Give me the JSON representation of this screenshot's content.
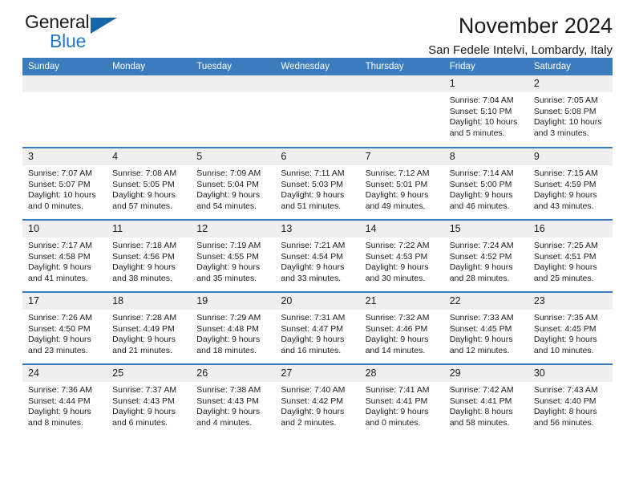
{
  "logo": {
    "primary_text": "General",
    "secondary_text": "Blue",
    "triangle_icon": "triangle-icon",
    "primary_color": "#1c1c1c",
    "secondary_color": "#2379c6",
    "triangle_color": "#1565a8"
  },
  "header": {
    "month_title": "November 2024",
    "location": "San Fedele Intelvi, Lombardy, Italy"
  },
  "colors": {
    "header_row_background": "#3a7cbe",
    "header_row_text": "#ffffff",
    "date_band_background": "#efefef",
    "cell_background": "#ffffff",
    "grid_line": "#3a7cbe",
    "body_text": "#1c1c1c"
  },
  "calendar": {
    "weekday_headers": [
      "Sunday",
      "Monday",
      "Tuesday",
      "Wednesday",
      "Thursday",
      "Friday",
      "Saturday"
    ],
    "weeks": [
      [
        {
          "day": "",
          "empty": true,
          "sunrise": "",
          "sunset": "",
          "daylight": ""
        },
        {
          "day": "",
          "empty": true,
          "sunrise": "",
          "sunset": "",
          "daylight": ""
        },
        {
          "day": "",
          "empty": true,
          "sunrise": "",
          "sunset": "",
          "daylight": ""
        },
        {
          "day": "",
          "empty": true,
          "sunrise": "",
          "sunset": "",
          "daylight": ""
        },
        {
          "day": "",
          "empty": true,
          "sunrise": "",
          "sunset": "",
          "daylight": ""
        },
        {
          "day": "1",
          "empty": false,
          "sunrise": "Sunrise: 7:04 AM",
          "sunset": "Sunset: 5:10 PM",
          "daylight": "Daylight: 10 hours and 5 minutes."
        },
        {
          "day": "2",
          "empty": false,
          "sunrise": "Sunrise: 7:05 AM",
          "sunset": "Sunset: 5:08 PM",
          "daylight": "Daylight: 10 hours and 3 minutes."
        }
      ],
      [
        {
          "day": "3",
          "empty": false,
          "sunrise": "Sunrise: 7:07 AM",
          "sunset": "Sunset: 5:07 PM",
          "daylight": "Daylight: 10 hours and 0 minutes."
        },
        {
          "day": "4",
          "empty": false,
          "sunrise": "Sunrise: 7:08 AM",
          "sunset": "Sunset: 5:05 PM",
          "daylight": "Daylight: 9 hours and 57 minutes."
        },
        {
          "day": "5",
          "empty": false,
          "sunrise": "Sunrise: 7:09 AM",
          "sunset": "Sunset: 5:04 PM",
          "daylight": "Daylight: 9 hours and 54 minutes."
        },
        {
          "day": "6",
          "empty": false,
          "sunrise": "Sunrise: 7:11 AM",
          "sunset": "Sunset: 5:03 PM",
          "daylight": "Daylight: 9 hours and 51 minutes."
        },
        {
          "day": "7",
          "empty": false,
          "sunrise": "Sunrise: 7:12 AM",
          "sunset": "Sunset: 5:01 PM",
          "daylight": "Daylight: 9 hours and 49 minutes."
        },
        {
          "day": "8",
          "empty": false,
          "sunrise": "Sunrise: 7:14 AM",
          "sunset": "Sunset: 5:00 PM",
          "daylight": "Daylight: 9 hours and 46 minutes."
        },
        {
          "day": "9",
          "empty": false,
          "sunrise": "Sunrise: 7:15 AM",
          "sunset": "Sunset: 4:59 PM",
          "daylight": "Daylight: 9 hours and 43 minutes."
        }
      ],
      [
        {
          "day": "10",
          "empty": false,
          "sunrise": "Sunrise: 7:17 AM",
          "sunset": "Sunset: 4:58 PM",
          "daylight": "Daylight: 9 hours and 41 minutes."
        },
        {
          "day": "11",
          "empty": false,
          "sunrise": "Sunrise: 7:18 AM",
          "sunset": "Sunset: 4:56 PM",
          "daylight": "Daylight: 9 hours and 38 minutes."
        },
        {
          "day": "12",
          "empty": false,
          "sunrise": "Sunrise: 7:19 AM",
          "sunset": "Sunset: 4:55 PM",
          "daylight": "Daylight: 9 hours and 35 minutes."
        },
        {
          "day": "13",
          "empty": false,
          "sunrise": "Sunrise: 7:21 AM",
          "sunset": "Sunset: 4:54 PM",
          "daylight": "Daylight: 9 hours and 33 minutes."
        },
        {
          "day": "14",
          "empty": false,
          "sunrise": "Sunrise: 7:22 AM",
          "sunset": "Sunset: 4:53 PM",
          "daylight": "Daylight: 9 hours and 30 minutes."
        },
        {
          "day": "15",
          "empty": false,
          "sunrise": "Sunrise: 7:24 AM",
          "sunset": "Sunset: 4:52 PM",
          "daylight": "Daylight: 9 hours and 28 minutes."
        },
        {
          "day": "16",
          "empty": false,
          "sunrise": "Sunrise: 7:25 AM",
          "sunset": "Sunset: 4:51 PM",
          "daylight": "Daylight: 9 hours and 25 minutes."
        }
      ],
      [
        {
          "day": "17",
          "empty": false,
          "sunrise": "Sunrise: 7:26 AM",
          "sunset": "Sunset: 4:50 PM",
          "daylight": "Daylight: 9 hours and 23 minutes."
        },
        {
          "day": "18",
          "empty": false,
          "sunrise": "Sunrise: 7:28 AM",
          "sunset": "Sunset: 4:49 PM",
          "daylight": "Daylight: 9 hours and 21 minutes."
        },
        {
          "day": "19",
          "empty": false,
          "sunrise": "Sunrise: 7:29 AM",
          "sunset": "Sunset: 4:48 PM",
          "daylight": "Daylight: 9 hours and 18 minutes."
        },
        {
          "day": "20",
          "empty": false,
          "sunrise": "Sunrise: 7:31 AM",
          "sunset": "Sunset: 4:47 PM",
          "daylight": "Daylight: 9 hours and 16 minutes."
        },
        {
          "day": "21",
          "empty": false,
          "sunrise": "Sunrise: 7:32 AM",
          "sunset": "Sunset: 4:46 PM",
          "daylight": "Daylight: 9 hours and 14 minutes."
        },
        {
          "day": "22",
          "empty": false,
          "sunrise": "Sunrise: 7:33 AM",
          "sunset": "Sunset: 4:45 PM",
          "daylight": "Daylight: 9 hours and 12 minutes."
        },
        {
          "day": "23",
          "empty": false,
          "sunrise": "Sunrise: 7:35 AM",
          "sunset": "Sunset: 4:45 PM",
          "daylight": "Daylight: 9 hours and 10 minutes."
        }
      ],
      [
        {
          "day": "24",
          "empty": false,
          "sunrise": "Sunrise: 7:36 AM",
          "sunset": "Sunset: 4:44 PM",
          "daylight": "Daylight: 9 hours and 8 minutes."
        },
        {
          "day": "25",
          "empty": false,
          "sunrise": "Sunrise: 7:37 AM",
          "sunset": "Sunset: 4:43 PM",
          "daylight": "Daylight: 9 hours and 6 minutes."
        },
        {
          "day": "26",
          "empty": false,
          "sunrise": "Sunrise: 7:38 AM",
          "sunset": "Sunset: 4:43 PM",
          "daylight": "Daylight: 9 hours and 4 minutes."
        },
        {
          "day": "27",
          "empty": false,
          "sunrise": "Sunrise: 7:40 AM",
          "sunset": "Sunset: 4:42 PM",
          "daylight": "Daylight: 9 hours and 2 minutes."
        },
        {
          "day": "28",
          "empty": false,
          "sunrise": "Sunrise: 7:41 AM",
          "sunset": "Sunset: 4:41 PM",
          "daylight": "Daylight: 9 hours and 0 minutes."
        },
        {
          "day": "29",
          "empty": false,
          "sunrise": "Sunrise: 7:42 AM",
          "sunset": "Sunset: 4:41 PM",
          "daylight": "Daylight: 8 hours and 58 minutes."
        },
        {
          "day": "30",
          "empty": false,
          "sunrise": "Sunrise: 7:43 AM",
          "sunset": "Sunset: 4:40 PM",
          "daylight": "Daylight: 8 hours and 56 minutes."
        }
      ]
    ]
  }
}
